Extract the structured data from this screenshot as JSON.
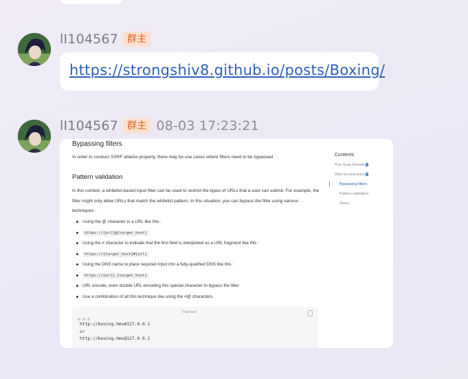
{
  "messages": [
    {
      "sender": "lI104567",
      "badge": "群主",
      "link": "https://strongshiv8.github.io/posts/Boxing/"
    },
    {
      "sender": "lI104567",
      "badge": "群主",
      "time": "08-03 17:23:21",
      "image": {
        "title": "Bypassing filters",
        "intro": "In order to conduct SSRF attacks properly, there may be use cases where filters need to be bypassed",
        "subtitle": "Pattern validation",
        "paragraph": "In this context, a whitelist-based input filter can be used to restrict the types of URLs that a user can submit. For example, the filter might only allow URLs that match the whitelist pattern. In this situation, you can bypass the filter using various techniques :",
        "bullets": [
          {
            "text": "Using the @ character in a URL like this :",
            "code": false
          },
          {
            "text": "https://{url}@{target_host}",
            "code": true
          },
          {
            "text": "Using the # character to indicate that the first field is interpreted as a URL fragment like this :",
            "code": false
          },
          {
            "text": "https://{target_host}#{url}",
            "code": true
          },
          {
            "text": "Using the DNS name to place required input into a fully-qualified DNS like this :",
            "code": false
          },
          {
            "text": "https://{url}.{target_host}",
            "code": true
          },
          {
            "text": "URL encode, even double URL encoding this special character to bypass the filter",
            "code": false
          },
          {
            "text": "Use a combination of all this technique like using the #@ characters.",
            "code": false
          }
        ],
        "code_block": {
          "language": "Plaintext",
          "lines": [
            "http://boxing.hmv#127.0.0.1",
            "or",
            "http://boxing.hmv@127.0.0.1"
          ]
        },
        "toc": {
          "title": "Contents",
          "items": [
            {
              "label": "Port Scan Results",
              "tag": "↓"
            },
            {
              "label": "Web Enumeration",
              "tag": "↓"
            },
            {
              "label": "Bypassing filters",
              "active": true
            },
            {
              "label": "Pattern validation"
            },
            {
              "label": "Steps:"
            }
          ]
        }
      }
    }
  ]
}
